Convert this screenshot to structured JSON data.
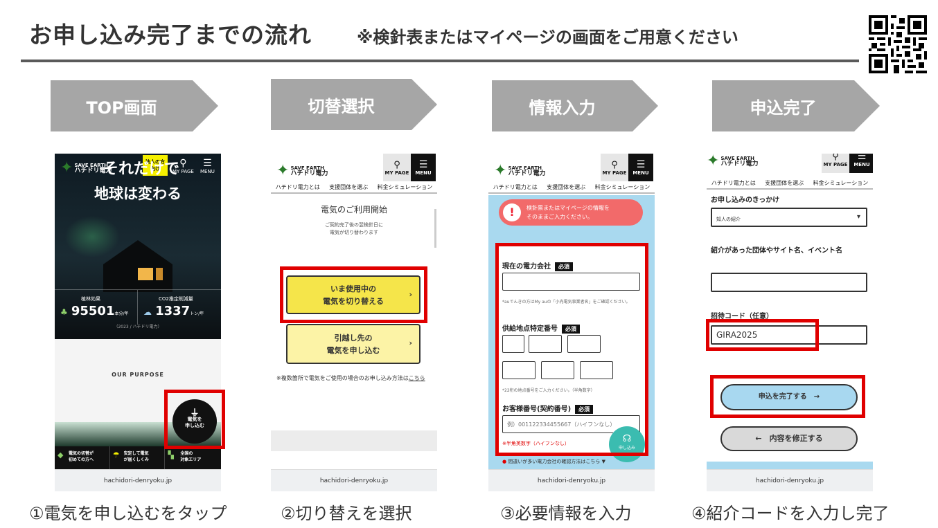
{
  "header": {
    "title": "お申し込み完了までの流れ",
    "subtitle": "※検針表またはマイページの画面をご用意ください"
  },
  "steps": [
    {
      "label": "TOP画面",
      "caption": "①電気を申し込むをタップ"
    },
    {
      "label": "切替選択",
      "caption": "②切り替えを選択"
    },
    {
      "label": "情報入力",
      "caption": "③必要情報を入力"
    },
    {
      "label": "申込完了",
      "caption": "④紹介コードを入力し完了"
    }
  ],
  "common": {
    "url": "hachidori-denryoku.jp",
    "logo_line1": "SAVE EARTH",
    "logo_line2": "ハチドリ電力",
    "mypage": "MY PAGE",
    "menu": "MENU",
    "nav": [
      "ハチドリ電力とは",
      "支援団体を選ぶ",
      "料金シミュレーション"
    ]
  },
  "screen1": {
    "corporate_badge": "法人の方\n向け",
    "hero_line1": "それだけで",
    "hero_line2": "地球は変わる",
    "stat1_label": "植林効果",
    "stat1_value": "95501",
    "stat1_unit": "本分/年",
    "stat2_label": "CO2推定削減量",
    "stat2_value": "1337",
    "stat2_unit": "トン/年",
    "stat_note": "（2023 / ハチドリ電力）",
    "purpose": "OUR PURPOSE",
    "apply_button": "電気を\n申し込む",
    "bottom_nav": [
      "電気の切替が\n初めての方へ",
      "安定して電気\nが届くしくみ",
      "全国の\n対象エリア"
    ]
  },
  "screen2": {
    "heading": "電気のご利用開始",
    "note": "ご契約完了後の翌検針日に\n電気が切り替わります",
    "option1": "いま使用中の\n電気を切り替える",
    "option2": "引越し先の\n電気を申し込む",
    "footnote": "※複数箇所で電気をご使用の場合のお申し込み方法は",
    "footnote_link": "こちら"
  },
  "screen3": {
    "alert": "検針票またはマイページの情報を\nそのままご入力ください。",
    "field1_label": "現在の電力会社",
    "required": "必須",
    "field1_hint": "*auでんきの方はMy auの「小売電気事業者名」をご確認ください。",
    "field2_label": "供給地点特定番号",
    "field2_hint": "*22桁の地点番号をご入力ください。（半角数字）",
    "field3_label": "お客様番号(契約番号)",
    "field3_placeholder": "例）001122334455667（ハイフンなし）",
    "field3_hint": "※半角英数字（ハイフンなし）",
    "help_button": "申し込み",
    "bottom_link": "間違いが多い電力会社の確認方法はこちら ▼"
  },
  "screen4": {
    "field1_label": "お申し込みのきっかけ",
    "field1_value": "知人の紹介",
    "field2_label": "紹介があった団体やサイト名、イベント名",
    "field3_label": "招待コード（任意）",
    "field3_value": "GIRA2025",
    "submit_button": "申込を完了する　→",
    "edit_button": "←　内容を修正する"
  },
  "colors": {
    "arrow_gray": "#a6a6a6",
    "highlight_red": "#e00000",
    "yellow": "#f5e54a",
    "submit_blue": "#a8d8f0"
  }
}
